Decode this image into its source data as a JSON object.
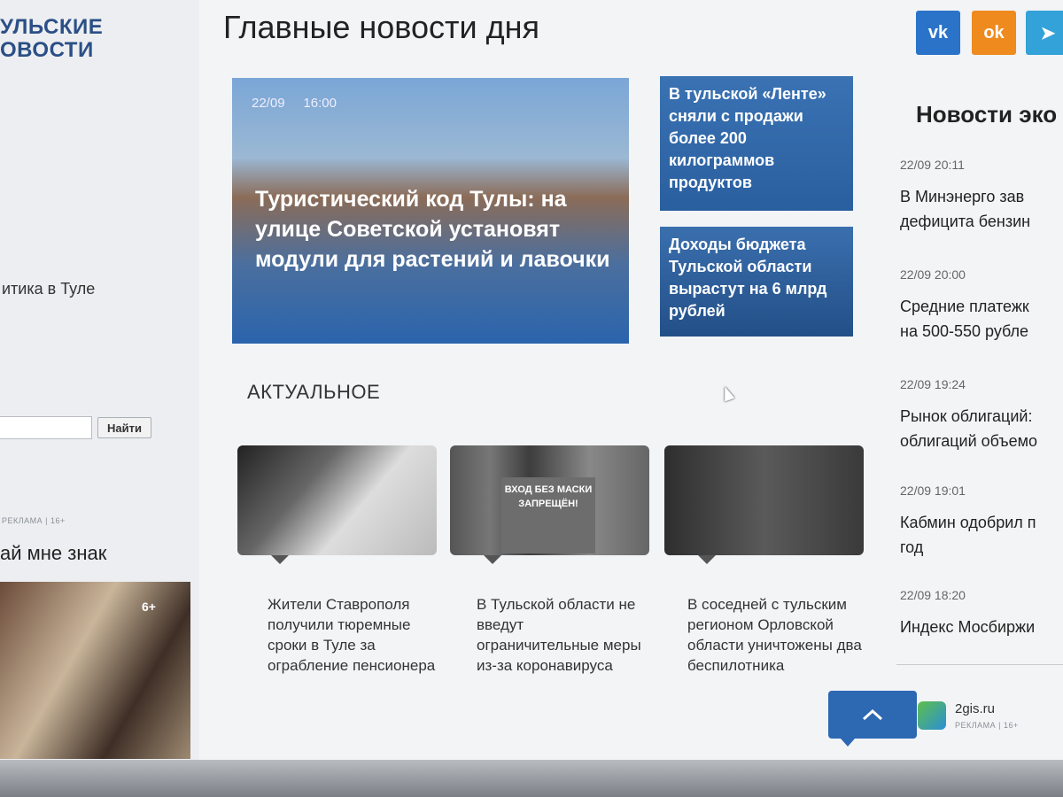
{
  "site": {
    "logo_line1": "УЛЬСКИЕ",
    "logo_line2": "ОВОСТИ"
  },
  "sidebar": {
    "menu_item": "итика в Туле",
    "search_button": "Найти",
    "ad_label": "РЕКЛАМА | 16+",
    "ad_title": "ай мне знак",
    "ad_age": "6+"
  },
  "main": {
    "title": "Главные новости дня",
    "feature": {
      "date": "22/09",
      "time": "16:00",
      "title": "Туристический код Тулы: на улице Советской установят модули для растений и лавочки"
    },
    "side_news": [
      "В тульской «Ленте» сняли с продажи более 200 килограммов продуктов",
      "Доходы бюджета Тульской области вырастут на 6 млрд рублей"
    ],
    "section_title": "АКТУАЛЬНОЕ",
    "cards": [
      {
        "text": "Жители Ставрополя получили тюремные сроки в Туле за ограбление пенсионера"
      },
      {
        "text": "В Тульской области не введут ограничительные меры из-за коронавируса",
        "sign_text": "ВХОД БЕЗ МАСКИ ЗАПРЕЩЁН!"
      },
      {
        "text": "В соседней с тульским регионом Орловской области уничтожены два беспилотника"
      }
    ]
  },
  "right": {
    "social": [
      "vk",
      "ok",
      "telegram"
    ],
    "title": "Новости эко",
    "feed": [
      {
        "time": "22/09  20:11",
        "text": "В Минэнерго зав"
      },
      {
        "time": "22/09  20:00",
        "text": "дефицита бензин"
      },
      {
        "time": "22/09  19:24",
        "text": "Средние платежк"
      },
      {
        "time": "22/09  19:01",
        "text": "на 500-550 рубле"
      },
      {
        "time": "22/09  18:20",
        "text": "Рынок облигаций:"
      }
    ],
    "feed_extra": [
      "облигаций объемо",
      "Кабмин одобрил п",
      "год",
      "Индекс Мосбиржи"
    ],
    "ad": {
      "title": "2gis.ru",
      "label": "РЕКЛАМА | 16+"
    }
  },
  "colors": {
    "accent_blue": "#2d68b2",
    "vk": "#2a73c8",
    "ok": "#ef8a1e",
    "telegram": "#33a2d8"
  }
}
